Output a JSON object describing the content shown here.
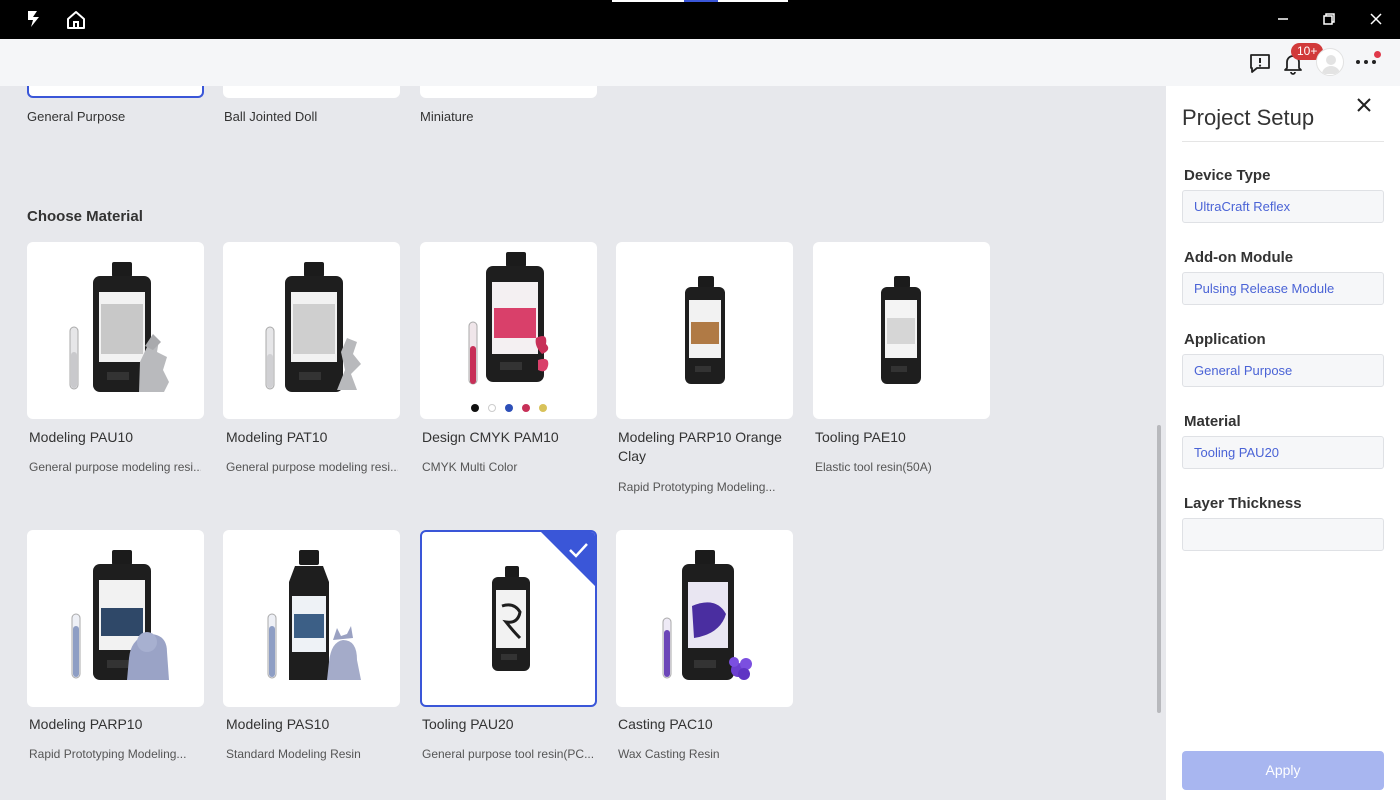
{
  "titlebar": {
    "icons": [
      "app-logo-icon",
      "home-icon",
      "minimize-icon",
      "restore-icon",
      "close-icon"
    ]
  },
  "header": {
    "notification_badge": "10+",
    "icons": [
      "feedback-icon",
      "bell-icon",
      "avatar",
      "more-icon"
    ]
  },
  "applications": [
    {
      "label": "General Purpose",
      "selected": true
    },
    {
      "label": "Ball Jointed Doll",
      "selected": false
    },
    {
      "label": "Miniature",
      "selected": false
    }
  ],
  "section": {
    "title": "Choose Material"
  },
  "materials": [
    {
      "name": "Modeling PAU10",
      "desc": "General purpose modeling resi...",
      "selected": false
    },
    {
      "name": "Modeling PAT10",
      "desc": "General purpose modeling resi...",
      "selected": false
    },
    {
      "name": "Design CMYK PAM10",
      "desc": "CMYK Multi Color",
      "selected": false,
      "color_dots": [
        "#111111",
        "#ffffff",
        "#2d4fb8",
        "#c73058",
        "#d8c25a"
      ]
    },
    {
      "name": "Modeling PARP10 Orange Clay",
      "desc": "Rapid Prototyping Modeling...",
      "selected": false
    },
    {
      "name": "Tooling PAE10",
      "desc": "Elastic tool resin(50A)",
      "selected": false
    },
    {
      "name": "Modeling PARP10",
      "desc": "Rapid Prototyping Modeling...",
      "selected": false
    },
    {
      "name": "Modeling PAS10",
      "desc": "Standard Modeling Resin",
      "selected": false
    },
    {
      "name": "Tooling PAU20",
      "desc": "General purpose tool resin(PC...",
      "selected": true
    },
    {
      "name": "Casting PAC10",
      "desc": "Wax Casting Resin",
      "selected": false
    }
  ],
  "panel": {
    "title": "Project Setup",
    "fields": [
      {
        "label": "Device Type",
        "value": "UltraCraft Reflex"
      },
      {
        "label": "Add-on Module",
        "value": "Pulsing Release Module"
      },
      {
        "label": "Application",
        "value": "General Purpose"
      },
      {
        "label": "Material",
        "value": "Tooling PAU20"
      },
      {
        "label": "Layer Thickness",
        "value": ""
      }
    ],
    "apply_label": "Apply"
  },
  "colors": {
    "accent": "#3a56d8",
    "apply_disabled": "#a8b6f0",
    "badge": "#d13a3a",
    "field_text": "#4a63d6"
  }
}
